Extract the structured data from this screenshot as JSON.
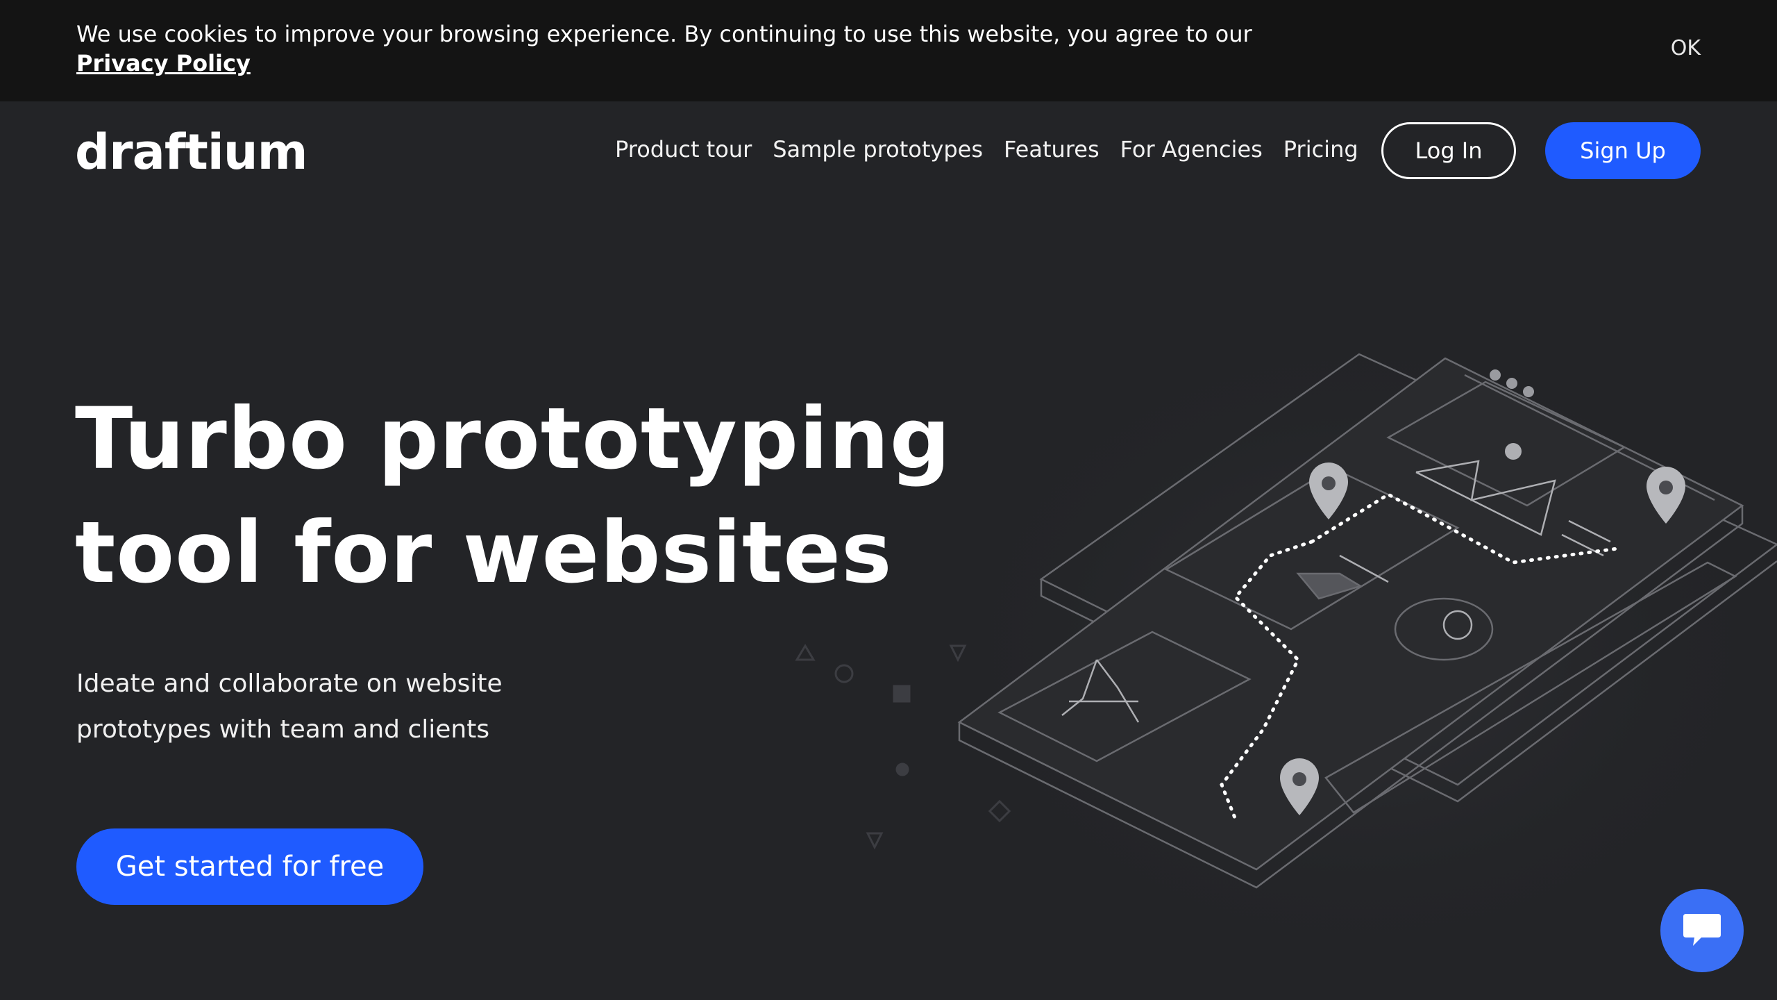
{
  "cookie": {
    "text": "We use cookies to improve your browsing experience. By continuing to use this website, you agree to our ",
    "link": "Privacy Policy",
    "ok": "OK"
  },
  "header": {
    "logo": "draftium",
    "nav": [
      "Product tour",
      "Sample prototypes",
      "Features",
      "For Agencies",
      "Pricing"
    ],
    "login": "Log In",
    "signup": "Sign Up"
  },
  "hero": {
    "title_line1": "Turbo prototyping",
    "title_line2": "tool for websites",
    "subtitle_line1": "Ideate and collaborate on website",
    "subtitle_line2": "prototypes with team and clients",
    "cta": "Get started for free"
  },
  "colors": {
    "background": "#232427",
    "cookie_bar": "#141414",
    "accent": "#1f5bff",
    "chat": "#3a6ff5"
  },
  "icons": {
    "chat": "chat-bubble-icon",
    "pin": "location-pin-icon"
  }
}
